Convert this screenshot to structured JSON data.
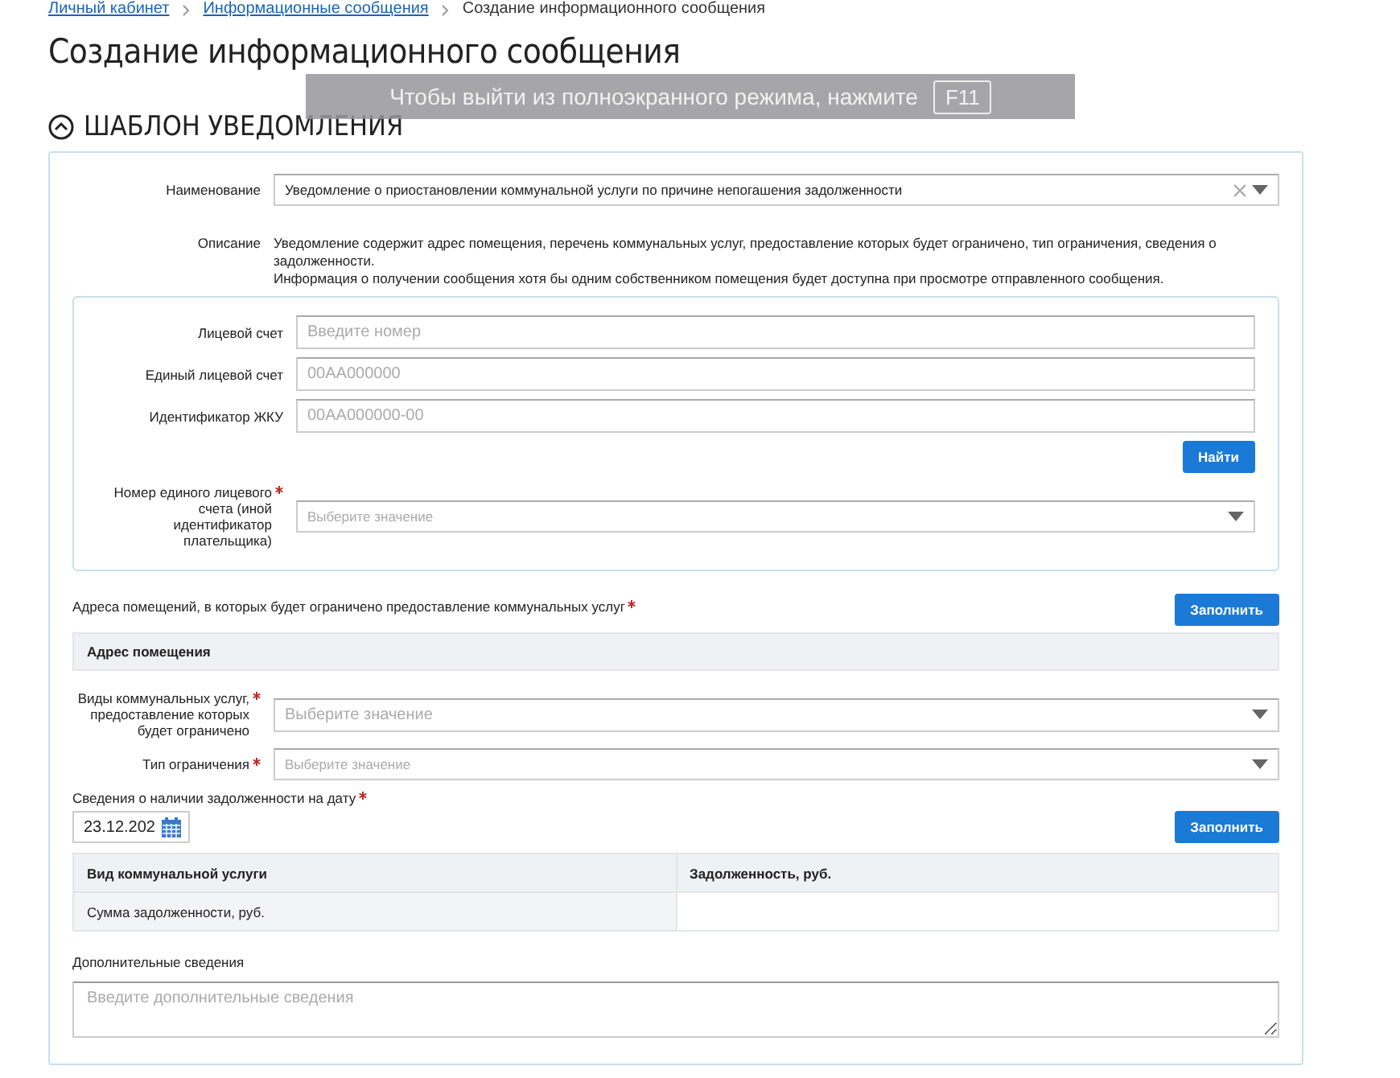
{
  "breadcrumbs": [
    {
      "label": "Личный кабинет",
      "link": true
    },
    {
      "label": "Информационные сообщения",
      "link": true
    },
    {
      "label": "Создание информационного сообщения",
      "link": false
    }
  ],
  "page_title": "Создание информационного сообщения",
  "fullscreen_notice": {
    "text": "Чтобы выйти из полноэкранного режима, нажмите",
    "key": "F11"
  },
  "section": {
    "title": "ШАБЛОН УВЕДОМЛЕНИЯ",
    "expanded": true
  },
  "name_field": {
    "label": "Наименование",
    "value": "Уведомление о приостановлении коммунальной услуги по причине непогашения задолженности"
  },
  "description": {
    "label": "Описание",
    "lines": [
      "Уведомление содержит адрес помещения, перечень коммунальных услуг, предоставление которых будет ограничено, тип ограничения, сведения о задолженности.",
      "Информация о получении сообщения хотя бы одним собственником помещения будет доступна при просмотре отправленного сообщения."
    ]
  },
  "search_panel": {
    "fields": [
      {
        "label": "Лицевой счет",
        "placeholder": "Введите номер"
      },
      {
        "label": "Единый лицевой счет",
        "placeholder": "00АА000000"
      },
      {
        "label": "Идентификатор ЖКУ",
        "placeholder": "00АА000000-00"
      }
    ],
    "button": "Найти",
    "select": {
      "label": "Номер единого лицевого счета (иной идентификатор плательщика)",
      "placeholder": "Выберите значение",
      "required": true
    }
  },
  "addresses": {
    "label": "Адреса помещений, в которых будет ограничено предоставление коммунальных услуг",
    "required": true,
    "button": "Заполнить",
    "table_header": "Адрес помещения"
  },
  "selects": [
    {
      "label": "Виды коммунальных услуг, предоставление которых будет ограничено",
      "placeholder": "Выберите значение",
      "required": true,
      "large": true
    },
    {
      "label": "Тип ограничения",
      "placeholder": "Выберите значение",
      "required": true,
      "large": false
    }
  ],
  "debt": {
    "label": "Сведения о наличии задолженности на дату",
    "required": true,
    "date": "23.12.202",
    "button": "Заполнить",
    "columns": [
      "Вид коммунальной услуги",
      "Задолженность, руб."
    ],
    "rows": [
      [
        "Сумма задолженности, руб.",
        ""
      ]
    ]
  },
  "additional": {
    "label": "Дополнительные сведения",
    "placeholder": "Введите дополнительные сведения"
  }
}
